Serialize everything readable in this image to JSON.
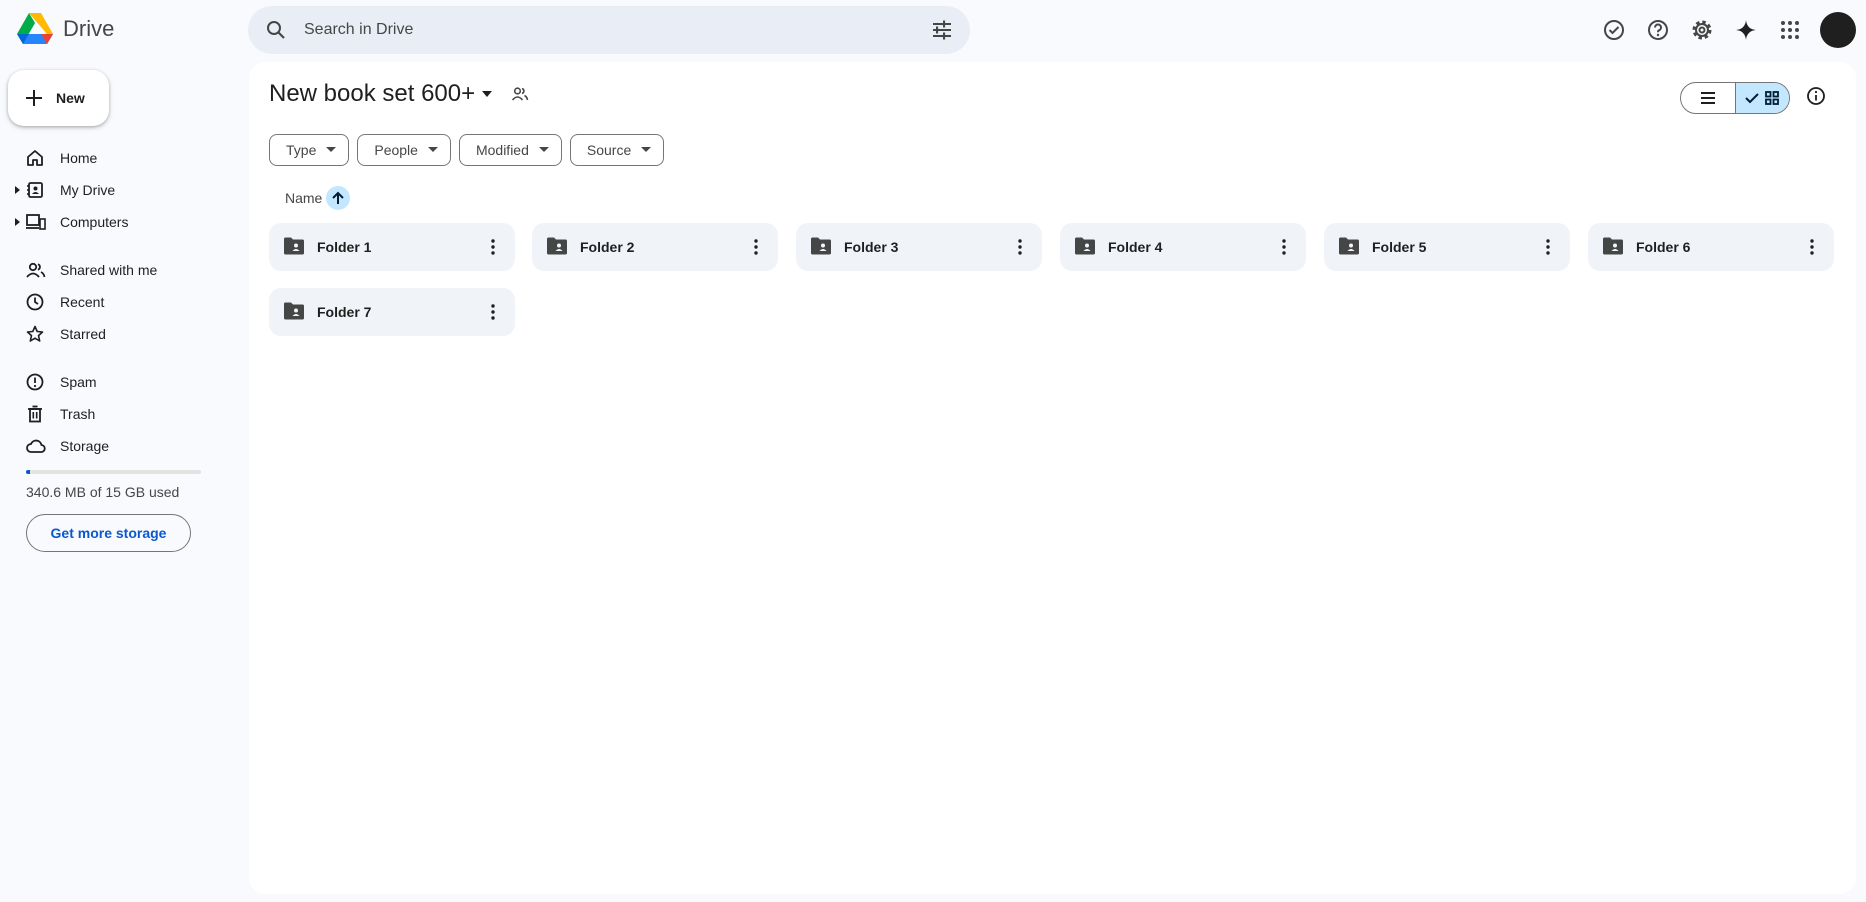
{
  "app": {
    "name": "Drive"
  },
  "search": {
    "placeholder": "Search in Drive",
    "value": ""
  },
  "header_icons": [
    "offline-status-icon",
    "help-icon",
    "settings-icon",
    "gemini-spark-icon",
    "apps-grid-icon",
    "account-avatar"
  ],
  "new_button": {
    "label": "New"
  },
  "sidebar": {
    "groups": [
      [
        {
          "id": "home",
          "label": "Home",
          "icon": "home-icon",
          "expandable": false
        },
        {
          "id": "my-drive",
          "label": "My Drive",
          "icon": "my-drive-icon",
          "expandable": true
        },
        {
          "id": "computers",
          "label": "Computers",
          "icon": "computers-icon",
          "expandable": true
        }
      ],
      [
        {
          "id": "shared",
          "label": "Shared with me",
          "icon": "shared-people-icon",
          "expandable": false
        },
        {
          "id": "recent",
          "label": "Recent",
          "icon": "clock-icon",
          "expandable": false
        },
        {
          "id": "starred",
          "label": "Starred",
          "icon": "star-icon",
          "expandable": false
        }
      ],
      [
        {
          "id": "spam",
          "label": "Spam",
          "icon": "spam-icon",
          "expandable": false
        },
        {
          "id": "trash",
          "label": "Trash",
          "icon": "trash-icon",
          "expandable": false
        },
        {
          "id": "storage",
          "label": "Storage",
          "icon": "cloud-icon",
          "expandable": false
        }
      ]
    ]
  },
  "storage": {
    "text": "340.6 MB of 15 GB used",
    "used_fraction": 0.022,
    "button_label": "Get more storage"
  },
  "main": {
    "title": "New book set 600+",
    "filters": [
      "Type",
      "People",
      "Modified",
      "Source"
    ],
    "sort": {
      "label": "Name",
      "direction": "ascending"
    },
    "view_mode": "grid",
    "folders": [
      "Folder 1",
      "Folder 2",
      "Folder 3",
      "Folder 4",
      "Folder 5",
      "Folder 6",
      "Folder 7"
    ]
  },
  "colors": {
    "accent": "#0b57d0",
    "selected": "#c2e7ff",
    "page_bg": "#f8fafd",
    "folder_bg": "#f0f4f9"
  }
}
